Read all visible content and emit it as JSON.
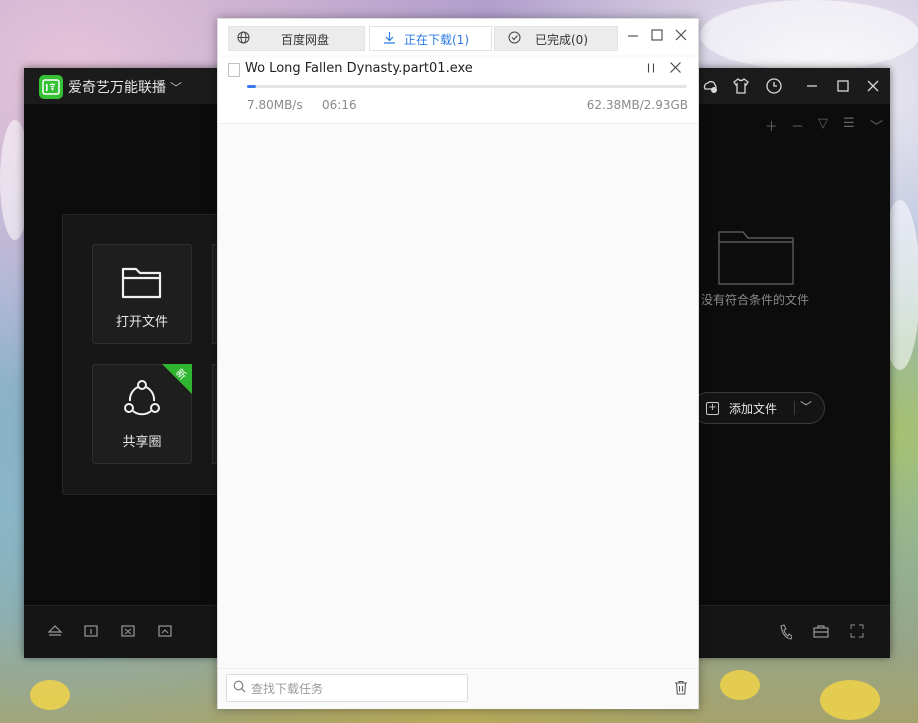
{
  "player": {
    "app_name": "爱奇艺万能联播",
    "tiles": [
      {
        "label": "打开文件"
      },
      {
        "label": "共享圈",
        "badge": "新"
      }
    ],
    "empty_text": "没有符合条件的文件",
    "add_file_label": "添加文件",
    "accent": "#35c035"
  },
  "downloader": {
    "tabs": [
      {
        "label": "百度网盘",
        "icon": "globe-icon",
        "active": false
      },
      {
        "label": "正在下载(1)",
        "icon": "download-icon",
        "active": true
      },
      {
        "label": "已完成(0)",
        "icon": "check-circle-icon",
        "active": false
      }
    ],
    "item": {
      "file_name": "Wo Long Fallen Dynasty.part01.exe",
      "speed": "7.80MB/s",
      "eta": "06:16",
      "size": "62.38MB/2.93GB",
      "progress_fraction": 0.021
    },
    "search_placeholder": "查找下载任务",
    "accent": "#3a7cf0"
  }
}
